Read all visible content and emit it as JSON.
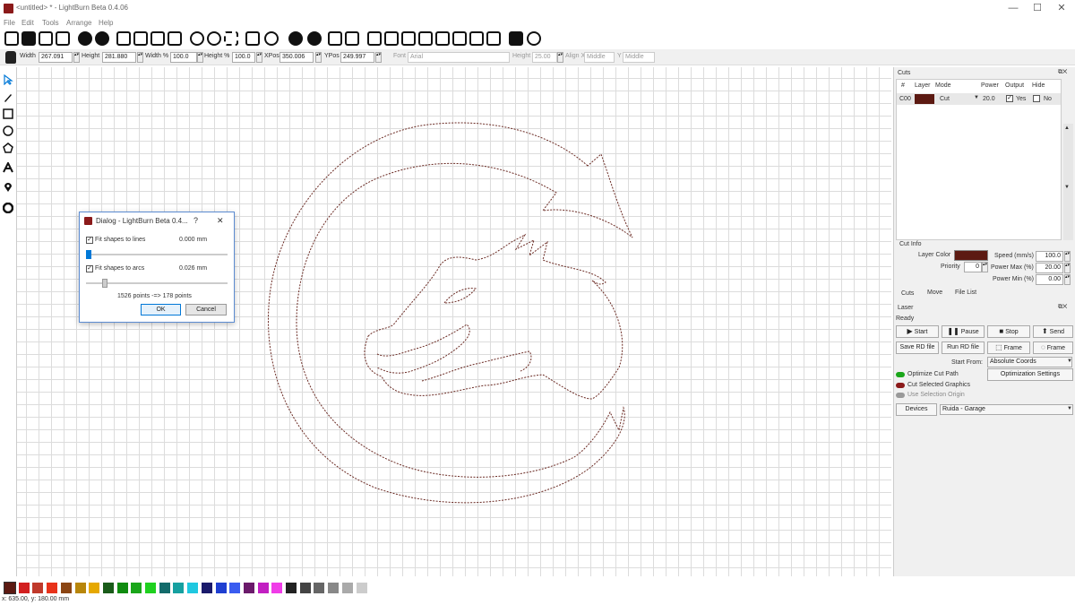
{
  "window": {
    "title": "<untitled> * - LightBurn Beta 0.4.06",
    "min": "—",
    "max": "☐",
    "close": "✕"
  },
  "menu": [
    "File",
    "Edit",
    "Tools",
    "Arrange",
    "Help"
  ],
  "numeric": {
    "width_label": "Width",
    "width": "267.091",
    "height_label": "Height",
    "height": "281.880",
    "width_pct_label": "Width %",
    "width_pct": "100.0",
    "height_pct_label": "Height %",
    "height_pct": "100.0",
    "xpos_label": "XPos",
    "xpos": "350.006",
    "ypos_label": "YPos",
    "ypos": "249.997",
    "font_label": "Font",
    "font": "Arial",
    "font_height_label": "Height",
    "font_height": "25.00",
    "alignx_label": "Align X",
    "alignx": "Middle",
    "aligny_label": "Y",
    "aligny": "Middle"
  },
  "dialog": {
    "title": "Dialog - LightBurn Beta 0.4...",
    "help": "?",
    "close": "✕",
    "lines_label": "Fit shapes to lines",
    "lines_value": "0.000 mm",
    "lines_slider": 0.0,
    "arcs_label": "Fit shapes to arcs",
    "arcs_value": "0.026 mm",
    "arcs_slider": 0.12,
    "points": "1526 points -=>  178 points",
    "ok": "OK",
    "cancel": "Cancel"
  },
  "cuts": {
    "title": "Cuts",
    "headers": [
      "#",
      "Layer",
      "Mode",
      "Power",
      "Output",
      "Hide"
    ],
    "row": {
      "num": "C00",
      "color": "#5c1a12",
      "mode": "Cut",
      "power": "20.0",
      "output": "Yes",
      "hide": "No"
    }
  },
  "cutinfo": {
    "title": "Cut Info",
    "layer_color_label": "Layer Color",
    "priority_label": "Priority",
    "priority": "0",
    "speed_label": "Speed (mm/s)",
    "speed": "100.0",
    "power_max_label": "Power Max (%)",
    "power_max": "20.00",
    "power_min_label": "Power Min (%)",
    "power_min": "0.00"
  },
  "tabs": [
    "Cuts",
    "Move",
    "File List"
  ],
  "laser": {
    "title": "Laser",
    "status": "Ready",
    "start": "Start",
    "pause": "Pause",
    "stop": "Stop",
    "send": "Send",
    "save_rd": "Save RD file",
    "run_rd": "Run RD file",
    "frame1": "Frame",
    "frame2": "Frame",
    "start_from_label": "Start From:",
    "start_from": "Absolute Coords",
    "optimize": "Optimize Cut Path",
    "opt_settings": "Optimization Settings",
    "cut_selected": "Cut Selected Graphics",
    "use_origin": "Use Selection Origin",
    "devices": "Devices",
    "device": "Ruida - Garage"
  },
  "palette": [
    "#5c1a12",
    "#d21f1f",
    "#c0392b",
    "#e8321a",
    "#8b4513",
    "#b8860b",
    "#e6a800",
    "#1a5c1a",
    "#108c10",
    "#1aa61a",
    "#1fd11f",
    "#136b6b",
    "#16a0a0",
    "#1fc8e0",
    "#1a1a6b",
    "#1f3fd1",
    "#3a5cf0",
    "#6b1a6b",
    "#c21fc2",
    "#f03ce8",
    "#222222",
    "#444444",
    "#666666",
    "#888888",
    "#aaaaaa",
    "#cccccc"
  ],
  "status": "x: 635.00, y: 180.00 mm",
  "accent": "#0078d7",
  "path_color": "#6b2b24"
}
